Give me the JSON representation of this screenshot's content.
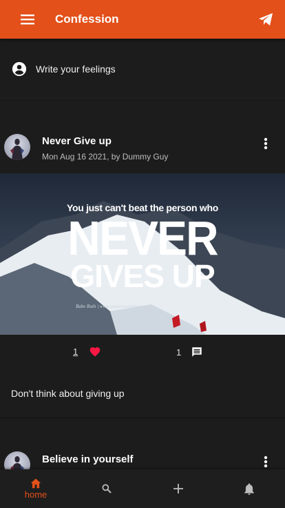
{
  "appbar": {
    "title": "Confession",
    "menu_icon": "menu-icon",
    "send_icon": "send-icon",
    "color": "#e3501a"
  },
  "composer": {
    "icon": "account-circle-icon",
    "placeholder": "Write your feelings"
  },
  "posts": [
    {
      "title": "Never Give up",
      "meta": "Mon Aug 16 2021, by Dummy Guy",
      "image": {
        "line1": "You just can't beat the person who",
        "line2": "NEVER",
        "line3": "GIVES UP",
        "credit": "Babe Ruth  |  www.quotesnsayings.com"
      },
      "likes": "1",
      "comments": "1",
      "body": "Don't think about giving up"
    },
    {
      "title": "Believe in yourself"
    }
  ],
  "bottom_nav": {
    "home_label": "home",
    "items": [
      "home-icon",
      "search-icon",
      "add-icon",
      "notifications-icon"
    ],
    "active_color": "#e3501a"
  }
}
